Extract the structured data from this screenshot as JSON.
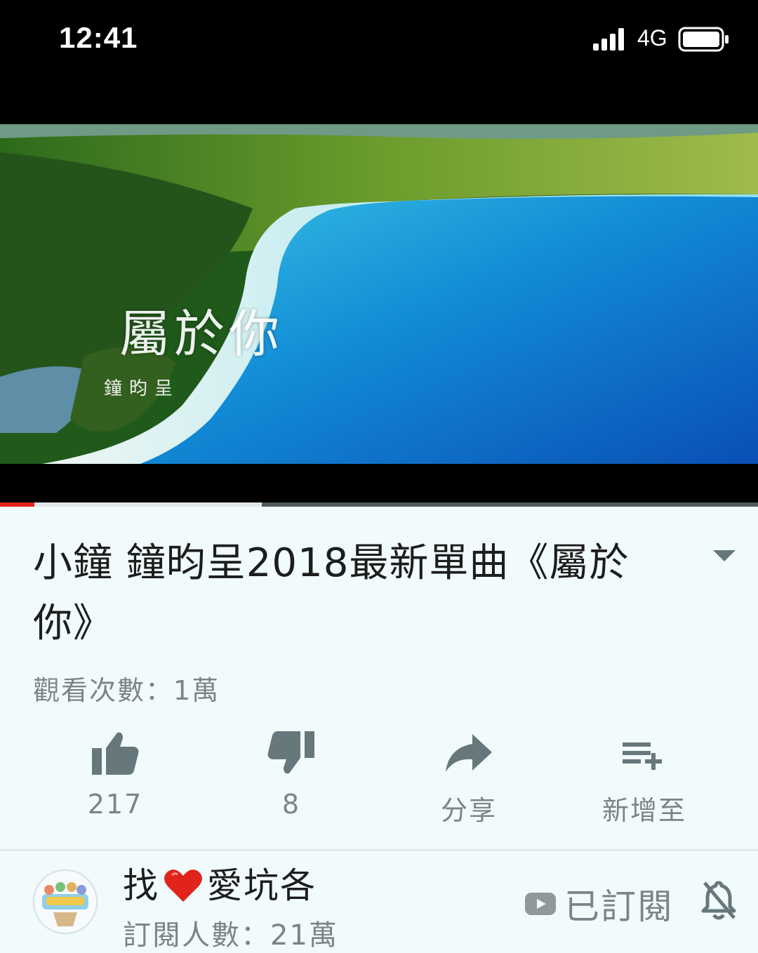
{
  "status_bar": {
    "time": "12:41",
    "network": "4G",
    "signal_icon": "signal-bars-icon",
    "battery_icon": "battery-icon"
  },
  "video": {
    "overlay_title": "屬於你",
    "overlay_artist": "鐘昀呈",
    "progress_played": 0.045,
    "progress_buffered": 0.345
  },
  "details": {
    "title": "小鐘 鐘昀呈2018最新單曲《屬於你》",
    "views": "觀看次數：1萬",
    "expand_icon": "chevron-down-icon"
  },
  "actions": {
    "like": {
      "icon": "thumbs-up-icon",
      "label": "217"
    },
    "dislike": {
      "icon": "thumbs-down-icon",
      "label": "8"
    },
    "share": {
      "icon": "share-icon",
      "label": "分享"
    },
    "add_to": {
      "icon": "playlist-add-icon",
      "label": "新增至"
    }
  },
  "channel": {
    "name_before": "找",
    "name_icon": "heart-icon",
    "name_after": "愛坑各",
    "subscribers": "訂閱人數：21萬",
    "subscribed_label": "已訂閱",
    "subscribed_icon": "youtube-icon",
    "bell_icon": "bell-off-icon"
  },
  "colors": {
    "accent": "#e2231a",
    "background": "#f1fbfc",
    "text": "#1d1d1d",
    "secondary_text": "#7b8486",
    "icon": "#66787b"
  }
}
